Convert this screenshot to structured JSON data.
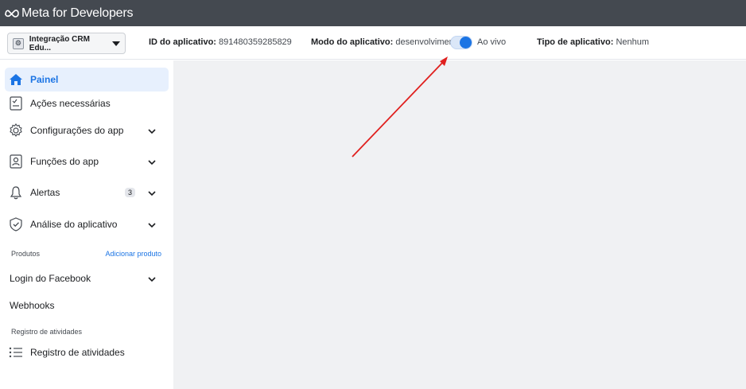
{
  "topbar": {
    "logo_text": "Meta for Developers"
  },
  "app_selector": {
    "label": "Integração CRM Edu..."
  },
  "info": {
    "app_id_label": "ID do aplicativo:",
    "app_id_value": "891480359285829",
    "mode_label": "Modo do aplicativo:",
    "mode_dev": "desenvolvimento",
    "mode_live": "Ao vivo",
    "type_label": "Tipo de aplicativo:",
    "type_value": "Nenhum"
  },
  "sidebar": {
    "items": [
      {
        "label": "Painel",
        "icon": "home-icon"
      },
      {
        "label": "Ações necessárias",
        "icon": "checklist-icon"
      },
      {
        "label": "Configurações do app",
        "icon": "gear-icon"
      },
      {
        "label": "Funções do app",
        "icon": "user-card-icon"
      },
      {
        "label": "Alertas",
        "icon": "bell-icon",
        "badge": "3"
      },
      {
        "label": "Análise do aplicativo",
        "icon": "shield-check-icon"
      }
    ],
    "products_section": "Produtos",
    "add_product": "Adicionar produto",
    "products": [
      {
        "label": "Login do Facebook"
      },
      {
        "label": "Webhooks"
      }
    ],
    "activity_section": "Registro de atividades",
    "activity_item": "Registro de atividades"
  },
  "colors": {
    "accent": "#1b74e4",
    "topbar": "#444950",
    "content_bg": "#f0f1f3",
    "arrow": "#e0201e"
  }
}
